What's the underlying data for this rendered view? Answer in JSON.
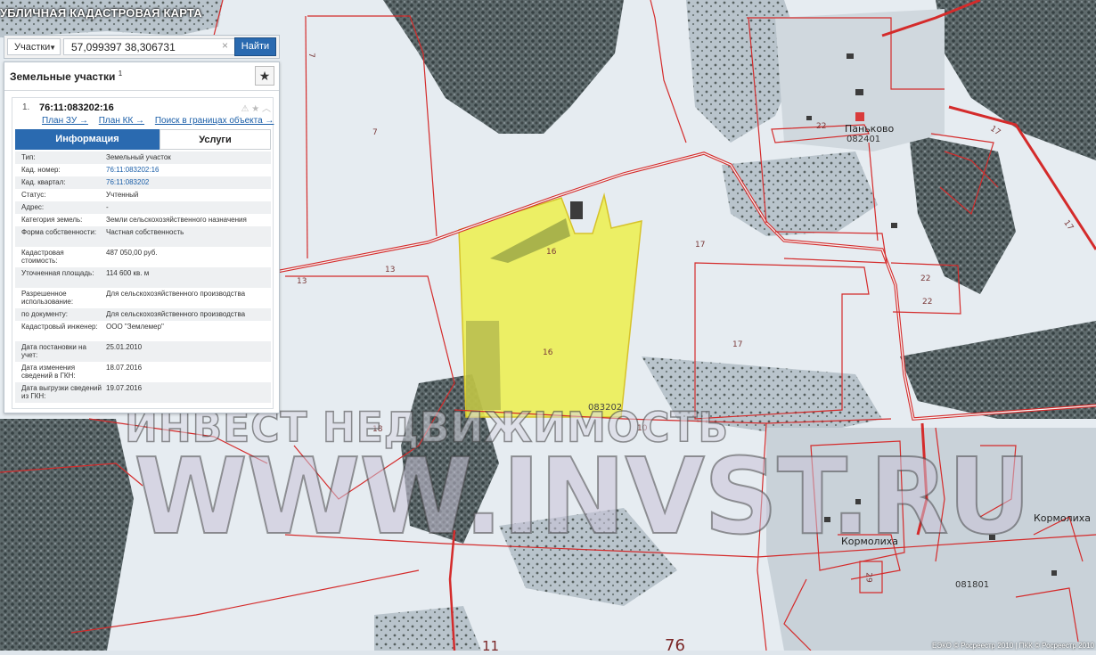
{
  "app_title": "УБЛИЧНАЯ КАДАСТРОВАЯ КАРТА",
  "search": {
    "layer": "Участки",
    "query": "57,099397 38,306731",
    "find_label": "Найти"
  },
  "panel": {
    "title": "Земельные участки",
    "count": "1",
    "item_index": "1.",
    "cad_number": "76:11:083202:16",
    "links": [
      "План ЗУ →",
      "План КК →",
      "Поиск в границах объекта →"
    ],
    "tabs": [
      "Информация",
      "Услуги"
    ],
    "attributes": [
      {
        "k": "Тип:",
        "v": "Земельный участок"
      },
      {
        "k": "Кад. номер:",
        "v": "76:11:083202:16",
        "link": true
      },
      {
        "k": "Кад. квартал:",
        "v": "76:11:083202",
        "link": true
      },
      {
        "k": "Статус:",
        "v": "Учтенный"
      },
      {
        "k": "Адрес:",
        "v": "-"
      },
      {
        "k": "Категория земель:",
        "v": "Земли сельскохозяйственного назначения"
      },
      {
        "k": "Форма собственности:",
        "v": "Частная собственность"
      },
      {
        "k": "Кадастровая стоимость:",
        "v": "487 050,00 руб."
      },
      {
        "k": "Уточненная площадь:",
        "v": "114 600 кв. м"
      },
      {
        "k": "Разрешенное использование:",
        "v": "Для сельскохозяйственного производства"
      },
      {
        "k": "по документу:",
        "v": "Для сельскохозяйственного производства"
      },
      {
        "k": "Кадастровый инженер:",
        "v": "ООО \"Землемер\""
      },
      {
        "k": "Дата постановки на учет:",
        "v": "25.01.2010"
      },
      {
        "k": "Дата изменения сведений в ГКН:",
        "v": "18.07.2016"
      },
      {
        "k": "Дата выгрузки сведений из ГКН:",
        "v": "19.07.2016"
      }
    ]
  },
  "map_labels": {
    "parcel_7": "7",
    "parcel_7b": "7",
    "parcel_13a": "13",
    "parcel_13b": "13",
    "parcel_16a": "16",
    "parcel_16b": "16",
    "parcel_17a": "17",
    "parcel_17b": "17",
    "parcel_17c": "17",
    "parcel_17d": "17",
    "parcel_22a": "22",
    "parcel_22b": "22",
    "parcel_22c": "22",
    "parcel_18": "18",
    "parcel_10": "10",
    "parcel_29": "29",
    "quarter_083202": "083202",
    "quarter_082401": "082401",
    "quarter_081801": "081801",
    "village_pankovo": "Паньково",
    "village_kormolikha": "Кормолиха",
    "village_kormolikha2": "Кормолиха",
    "big_11": "11",
    "big_76": "76"
  },
  "watermark": {
    "line1": "ИНВЕСТ НЕДВИЖИМОСТЬ",
    "line2": "WWW.INVST.RU"
  },
  "copyright": "ЕЭКО © Росреестр 2010 | ПКК © Росреестр 2010",
  "colors": {
    "parcel_border": "#d42b2b",
    "selected_fill": "#ecf04c",
    "accent_blue": "#2a6ab0",
    "snow": "#e4eaf0",
    "forest": "#4f5a5c"
  }
}
